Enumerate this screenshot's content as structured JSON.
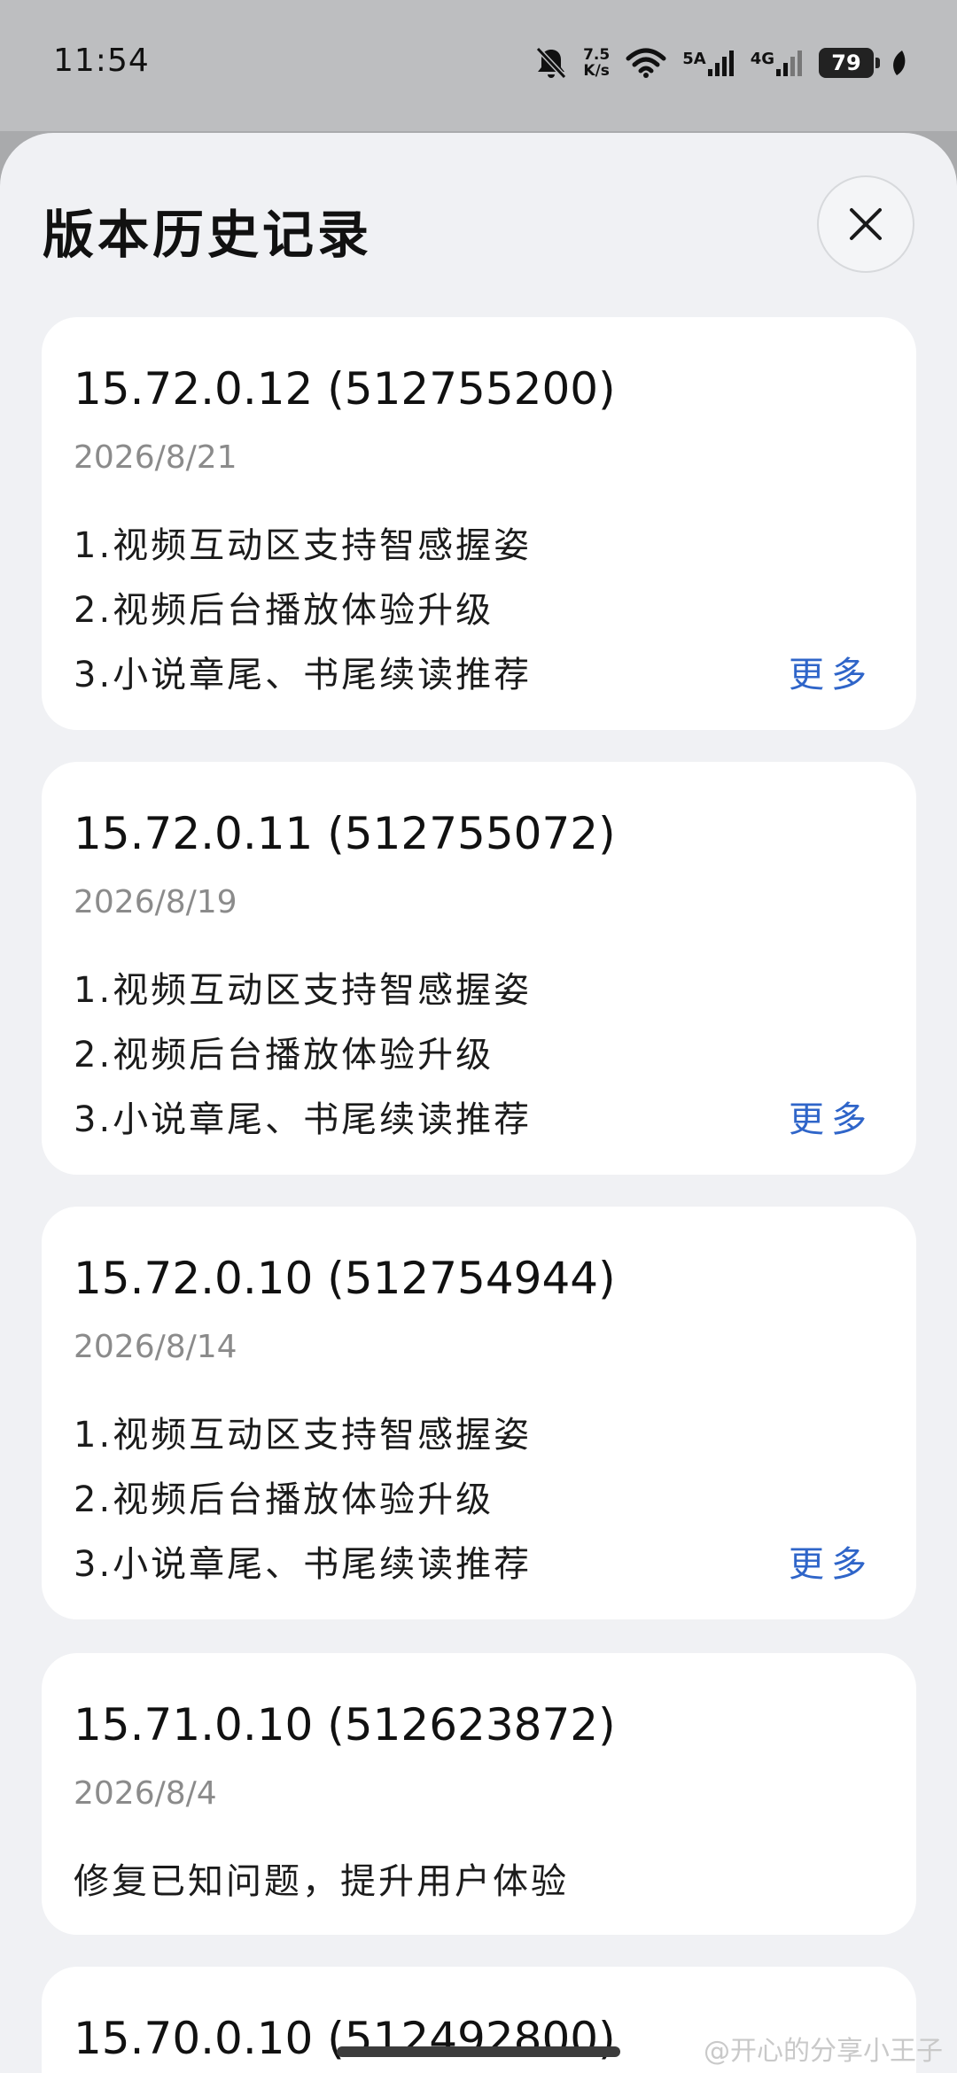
{
  "status_bar": {
    "time": "11:54",
    "net_speed_value": "7.5",
    "net_speed_unit": "K/s",
    "sim1_label": "5A",
    "sim2_label": "4G",
    "battery_level": "79"
  },
  "sheet": {
    "title": "版本历史记录",
    "more_label": "更多",
    "versions": [
      {
        "version": "15.72.0.12 (512755200)",
        "date": "2026/8/21",
        "notes": [
          "1.视频互动区支持智感握姿",
          "2.视频后台播放体验升级",
          "3.小说章尾、书尾续读推荐"
        ]
      },
      {
        "version": "15.72.0.11 (512755072)",
        "date": "2026/8/19",
        "notes": [
          "1.视频互动区支持智感握姿",
          "2.视频后台播放体验升级",
          "3.小说章尾、书尾续读推荐"
        ]
      },
      {
        "version": "15.72.0.10 (512754944)",
        "date": "2026/8/14",
        "notes": [
          "1.视频互动区支持智感握姿",
          "2.视频后台播放体验升级",
          "3.小说章尾、书尾续读推荐"
        ]
      },
      {
        "version": "15.71.0.10 (512623872)",
        "date": "2026/8/4",
        "notes": [
          "修复已知问题，提升用户体验"
        ]
      },
      {
        "version": "15.70.0.10 (512492800)"
      }
    ]
  },
  "watermark": "@开心的分享小王子"
}
